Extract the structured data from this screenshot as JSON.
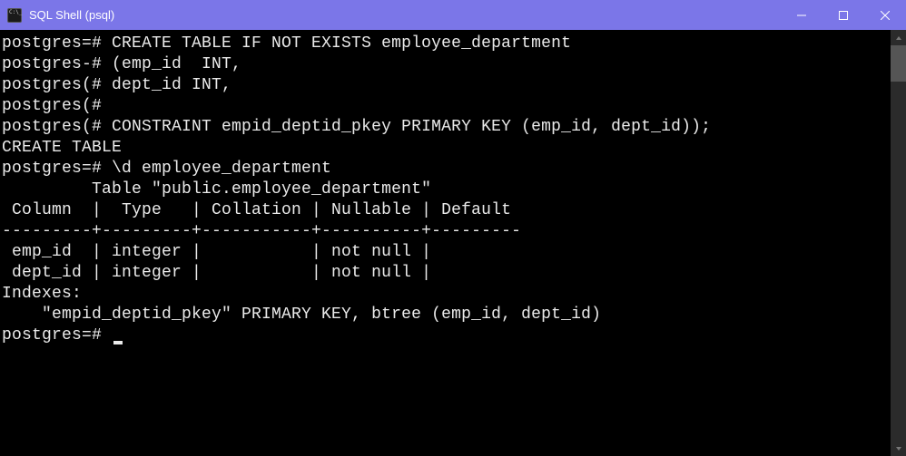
{
  "window": {
    "title": "SQL Shell (psql)"
  },
  "terminal": {
    "lines": [
      "postgres=# CREATE TABLE IF NOT EXISTS employee_department",
      "postgres-# (emp_id  INT,",
      "postgres(# dept_id INT,",
      "postgres(#",
      "postgres(# CONSTRAINT empid_deptid_pkey PRIMARY KEY (emp_id, dept_id));",
      "CREATE TABLE",
      "postgres=# \\d employee_department",
      "         Table \"public.employee_department\"",
      " Column  |  Type   | Collation | Nullable | Default",
      "---------+---------+-----------+----------+---------",
      " emp_id  | integer |           | not null |",
      " dept_id | integer |           | not null |",
      "Indexes:",
      "    \"empid_deptid_pkey\" PRIMARY KEY, btree (emp_id, dept_id)",
      "",
      "",
      "postgres=# "
    ]
  }
}
